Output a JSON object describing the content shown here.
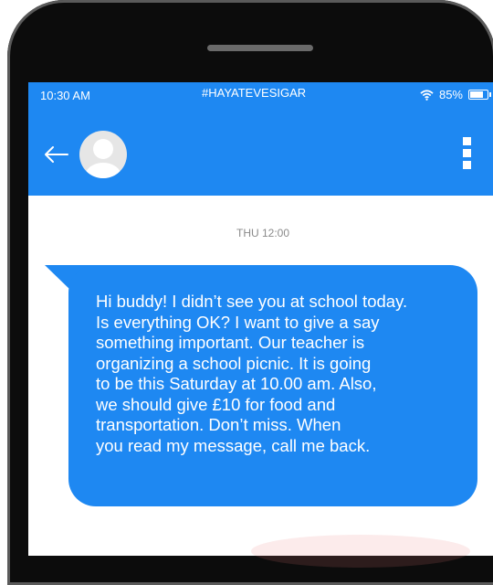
{
  "status_bar": {
    "time": "10:30 AM",
    "carrier": "#HAYATEVESIGAR",
    "battery_percent": "85%"
  },
  "header": {
    "back_icon": "arrow-left-icon",
    "avatar_icon": "person-avatar-icon",
    "menu_icon": "vertical-dots-icon"
  },
  "chat": {
    "timestamp": "THU 12:00",
    "messages": [
      {
        "text": "Hi buddy! I didn’t see you at school today.\nIs everything OK? I want to give a say\nsomething important. Our teacher is\norganizing a school picnic. It is going\nto be this Saturday at 10.00 am. Also,\nwe should give £10 for food and\ntransportation. Don’t miss.  When\nyou read my message, call me back."
      }
    ]
  },
  "colors": {
    "accent": "#1e88f2",
    "phone_body": "#0c0c0c",
    "timestamp": "#8a8a8a"
  }
}
